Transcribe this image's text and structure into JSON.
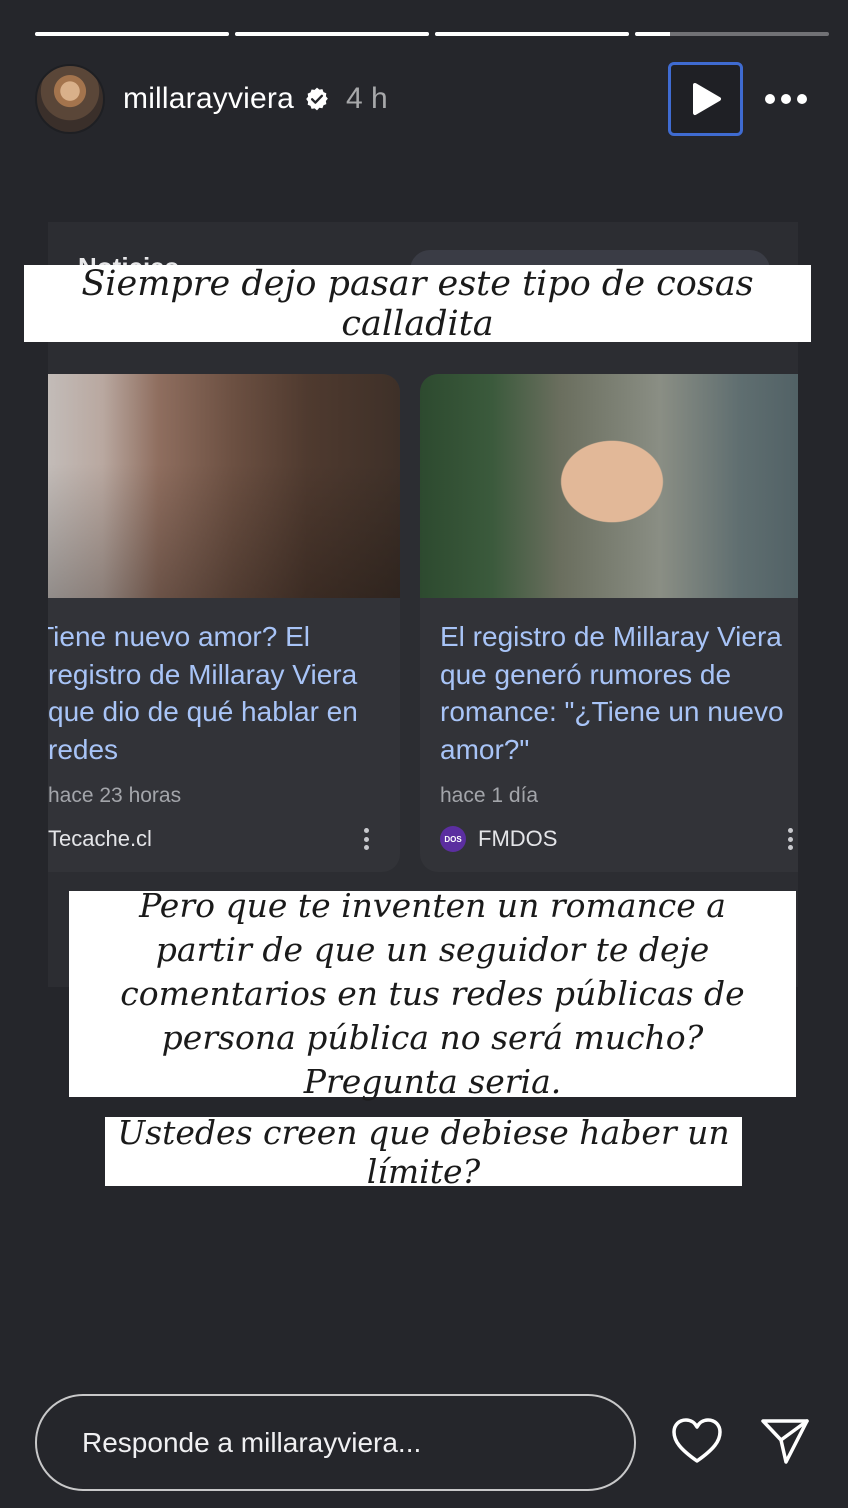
{
  "story": {
    "progress": [
      1,
      1,
      1,
      0.18
    ]
  },
  "header": {
    "username": "millarayviera",
    "time": "4 h",
    "icons": {
      "verified": "verified-badge-icon",
      "play": "play-icon",
      "more": "more-dots-icon"
    }
  },
  "screenshot_bg": {
    "title_fragment": "Noticias"
  },
  "captions": {
    "top": "Siempre dejo pasar este tipo de cosas calladita",
    "middle": "Pero que te inventen un romance a partir de que un seguidor te deje comentarios en tus redes públicas de persona pública no será mucho? Pregunta seria.",
    "bottom": "Ustedes creen que debiese haber un límite?"
  },
  "news_cards": [
    {
      "headline": "¿Tiene nuevo amor? El registro de Millaray Viera que dio de qué hablar en redes",
      "when": "hace 23 horas",
      "source": "Tecache.cl"
    },
    {
      "headline": "El registro de Millaray Viera que generó rumores de romance: \"¿Tiene un nuevo amor?\"",
      "when": "hace 1 día",
      "source": "FMDOS",
      "source_logo_text": "DOS"
    }
  ],
  "footer": {
    "reply_placeholder": "Responde a millarayviera...",
    "icons": {
      "like": "heart-icon",
      "share": "send-icon"
    }
  },
  "colors": {
    "background": "#25262b",
    "link": "#a8c4f7",
    "play_border": "#3f6bd1"
  }
}
